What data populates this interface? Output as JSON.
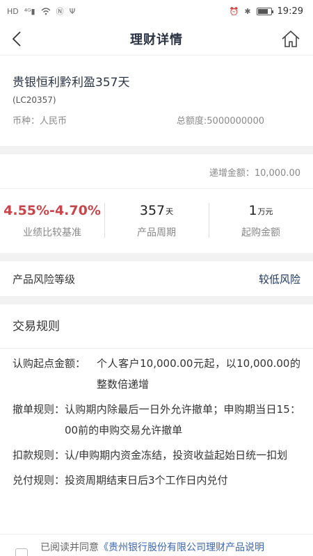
{
  "status_bar": {
    "icons": [
      "hd-icon",
      "signal-4g-icon",
      "wifi-icon",
      "nfc-icon",
      "usb-icon",
      "alarm-icon",
      "bluetooth-icon",
      "battery-icon"
    ],
    "time": "19:29"
  },
  "nav": {
    "title": "理财详情",
    "back_icon": "chevron-left-icon",
    "home_icon": "home-icon"
  },
  "product": {
    "name": "贵银恒利黔利盈357天",
    "code": "(LC20357)",
    "currency": "币种：人民币",
    "total_amount": "总额度:5000000000"
  },
  "stats": {
    "step_amount": "递增金额：10,000.00",
    "rate": {
      "value": "4.55%-4.70%",
      "label": "业绩比较基准",
      "color": "#c8454a"
    },
    "period": {
      "value": "357",
      "unit": "天",
      "label": "产品周期"
    },
    "min_buy": {
      "value": "1",
      "unit": "万元",
      "label": "起购金额"
    }
  },
  "risk": {
    "label": "产品风险等级",
    "value": "较低风险"
  },
  "rules": {
    "title": "交易规则",
    "items": [
      {
        "key": "认购起点金额：",
        "value": "个人客户10,000.00元起，以10,000.00的整数倍递增"
      },
      {
        "key": "撤单规则：",
        "value": "认购期内除最后一日外允许撤单；申购期当日15：00前的申购交易允许撤单"
      },
      {
        "key": "扣款规则：",
        "value": "认/申购期内资金冻结，投资收益起始日统一扣划"
      },
      {
        "key": "兑付规则：",
        "value": "投资周期结束日后3个工作日内兑付"
      }
    ]
  },
  "agreement": {
    "prefix": "已阅读并同意",
    "link": "《贵州银行股份有限公司理财产品说明"
  }
}
